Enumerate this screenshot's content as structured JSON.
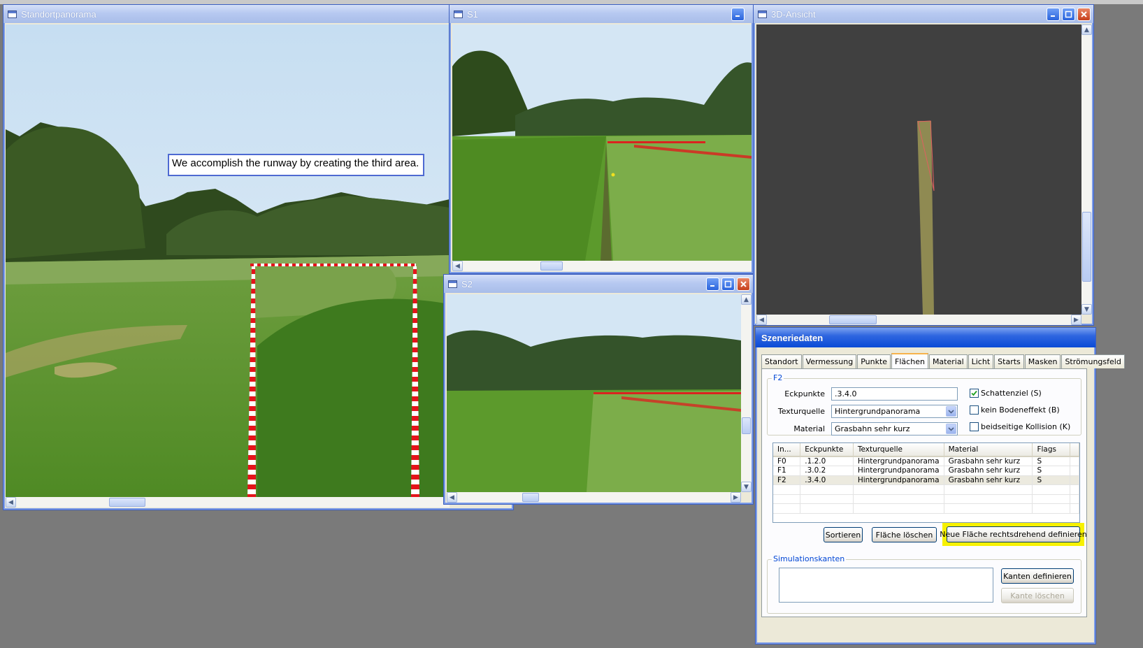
{
  "windows": {
    "standortpanorama": {
      "title": "Standortpanorama",
      "callout": "We accomplish the runway by creating the third area."
    },
    "s1": {
      "title": "S1"
    },
    "s2": {
      "title": "S2"
    },
    "ansicht3d": {
      "title": "3D-Ansicht"
    }
  },
  "szenerie": {
    "title": "Szeneriedaten",
    "tabs": [
      "Standort",
      "Vermessung",
      "Punkte",
      "Flächen",
      "Material",
      "Licht",
      "Starts",
      "Masken",
      "Strömungsfeld"
    ],
    "active_tab": "Flächen",
    "group_label": "F2",
    "eckpunkte_label": "Eckpunkte",
    "eckpunkte_value": ".3.4.0",
    "texturquelle_label": "Texturquelle",
    "texturquelle_value": "Hintergrundpanorama",
    "material_label": "Material",
    "material_value": "Grasbahn sehr kurz",
    "checkboxes": [
      {
        "label": "Schattenziel (S)",
        "checked": true
      },
      {
        "label": "kein Bodeneffekt (B)",
        "checked": false
      },
      {
        "label": "beidseitige Kollision (K)",
        "checked": false
      }
    ],
    "table": {
      "columns": [
        "In...",
        "Eckpunkte",
        "Texturquelle",
        "Material",
        "Flags"
      ],
      "rows": [
        [
          "F0",
          ".1.2.0",
          "Hintergrundpanorama",
          "Grasbahn sehr kurz",
          "S"
        ],
        [
          "F1",
          ".3.0.2",
          "Hintergrundpanorama",
          "Grasbahn sehr kurz",
          "S"
        ],
        [
          "F2",
          ".3.4.0",
          "Hintergrundpanorama",
          "Grasbahn sehr kurz",
          "S"
        ]
      ],
      "selected_row": 2
    },
    "buttons": {
      "sortieren": "Sortieren",
      "flaeche_loeschen": "Fläche löschen",
      "neue_flaeche": "Neue Fläche rechtsdrehend definieren"
    },
    "sim_group_label": "Simulationskanten",
    "kanten_definieren": "Kanten definieren",
    "kante_loeschen": "Kante löschen"
  },
  "colors": {
    "accent_highlight": "#f7f100",
    "titlebar_active": "#0a4bd6",
    "tape_red": "#e4141b"
  }
}
